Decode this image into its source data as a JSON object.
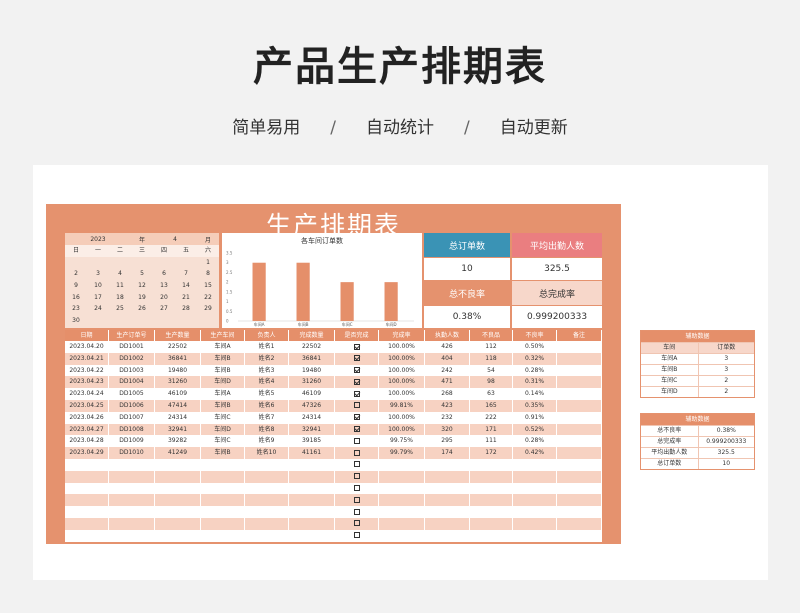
{
  "hero": {
    "title": "产品生产排期表",
    "tags": [
      "简单易用",
      "自动统计",
      "自动更新"
    ],
    "separator": "/"
  },
  "sheet": {
    "title": "生产排期表"
  },
  "calendar": {
    "year": "2023",
    "year_label": "年",
    "month": "4",
    "month_label": "月",
    "weekdays": [
      "日",
      "一",
      "二",
      "三",
      "四",
      "五",
      "六"
    ],
    "days": [
      "",
      "",
      "",
      "",
      "",
      "",
      "1",
      "2",
      "3",
      "4",
      "5",
      "6",
      "7",
      "8",
      "9",
      "10",
      "11",
      "12",
      "13",
      "14",
      "15",
      "16",
      "17",
      "18",
      "19",
      "20",
      "21",
      "22",
      "23",
      "24",
      "25",
      "26",
      "27",
      "28",
      "29",
      "30",
      "",
      "",
      "",
      "",
      "",
      ""
    ]
  },
  "chart_data": {
    "type": "bar",
    "title": "各车间订单数",
    "categories": [
      "车间A",
      "车间B",
      "车间C",
      "车间D"
    ],
    "values": [
      3,
      3,
      2,
      2
    ],
    "ylim": [
      0,
      3.5
    ],
    "yticks": [
      "3.5",
      "3",
      "2.5",
      "2",
      "1.5",
      "1",
      "0.5",
      "0"
    ],
    "bar_color": "#e58f6a"
  },
  "kpis": {
    "order_count_label": "总订单数",
    "order_count": "10",
    "avg_attendance_label": "平均出勤人数",
    "avg_attendance": "325.5",
    "defect_rate_label": "总不良率",
    "defect_rate": "0.38%",
    "completion_rate_label": "总完成率",
    "completion_rate": "0.999200333"
  },
  "table": {
    "headers": [
      "日期",
      "生产订单号",
      "生产数量",
      "生产车间",
      "负责人",
      "完成数量",
      "是否完成",
      "完成率",
      "执勤人数",
      "不良品",
      "不良率",
      "备注"
    ],
    "rows": [
      [
        "2023.04.20",
        "DD1001",
        "22502",
        "车间A",
        "姓名1",
        "22502",
        true,
        "100.00%",
        "426",
        "112",
        "0.50%",
        ""
      ],
      [
        "2023.04.21",
        "DD1002",
        "36841",
        "车间B",
        "姓名2",
        "36841",
        true,
        "100.00%",
        "404",
        "118",
        "0.32%",
        ""
      ],
      [
        "2023.04.22",
        "DD1003",
        "19480",
        "车间B",
        "姓名3",
        "19480",
        true,
        "100.00%",
        "242",
        "54",
        "0.28%",
        ""
      ],
      [
        "2023.04.23",
        "DD1004",
        "31260",
        "车间D",
        "姓名4",
        "31260",
        true,
        "100.00%",
        "471",
        "98",
        "0.31%",
        ""
      ],
      [
        "2023.04.24",
        "DD1005",
        "46109",
        "车间A",
        "姓名5",
        "46109",
        true,
        "100.00%",
        "268",
        "63",
        "0.14%",
        ""
      ],
      [
        "2023.04.25",
        "DD1006",
        "47414",
        "车间B",
        "姓名6",
        "47326",
        false,
        "99.81%",
        "423",
        "165",
        "0.35%",
        ""
      ],
      [
        "2023.04.26",
        "DD1007",
        "24314",
        "车间C",
        "姓名7",
        "24314",
        true,
        "100.00%",
        "232",
        "222",
        "0.91%",
        ""
      ],
      [
        "2023.04.27",
        "DD1008",
        "32941",
        "车间D",
        "姓名8",
        "32941",
        true,
        "100.00%",
        "320",
        "171",
        "0.52%",
        ""
      ],
      [
        "2023.04.28",
        "DD1009",
        "39282",
        "车间C",
        "姓名9",
        "39185",
        false,
        "99.75%",
        "295",
        "111",
        "0.28%",
        ""
      ],
      [
        "2023.04.29",
        "DD1010",
        "41249",
        "车间B",
        "姓名10",
        "41161",
        false,
        "99.79%",
        "174",
        "172",
        "0.42%",
        ""
      ],
      [
        "",
        "",
        "",
        "",
        "",
        "",
        false,
        "",
        "",
        "",
        "",
        ""
      ],
      [
        "",
        "",
        "",
        "",
        "",
        "",
        false,
        "",
        "",
        "",
        "",
        ""
      ],
      [
        "",
        "",
        "",
        "",
        "",
        "",
        false,
        "",
        "",
        "",
        "",
        ""
      ],
      [
        "",
        "",
        "",
        "",
        "",
        "",
        false,
        "",
        "",
        "",
        "",
        ""
      ],
      [
        "",
        "",
        "",
        "",
        "",
        "",
        false,
        "",
        "",
        "",
        "",
        ""
      ],
      [
        "",
        "",
        "",
        "",
        "",
        "",
        false,
        "",
        "",
        "",
        "",
        ""
      ],
      [
        "",
        "",
        "",
        "",
        "",
        "",
        false,
        "",
        "",
        "",
        "",
        ""
      ]
    ]
  },
  "aux1": {
    "title": "辅助数据",
    "header": [
      "车间",
      "订单数"
    ],
    "rows": [
      [
        "车间A",
        "3"
      ],
      [
        "车间B",
        "3"
      ],
      [
        "车间C",
        "2"
      ],
      [
        "车间D",
        "2"
      ]
    ]
  },
  "aux2": {
    "title": "辅助数据",
    "rows": [
      [
        "总不良率",
        "0.38%"
      ],
      [
        "总完成率",
        "0.999200333"
      ],
      [
        "平均出勤人数",
        "325.5"
      ],
      [
        "总订单数",
        "10"
      ]
    ]
  }
}
